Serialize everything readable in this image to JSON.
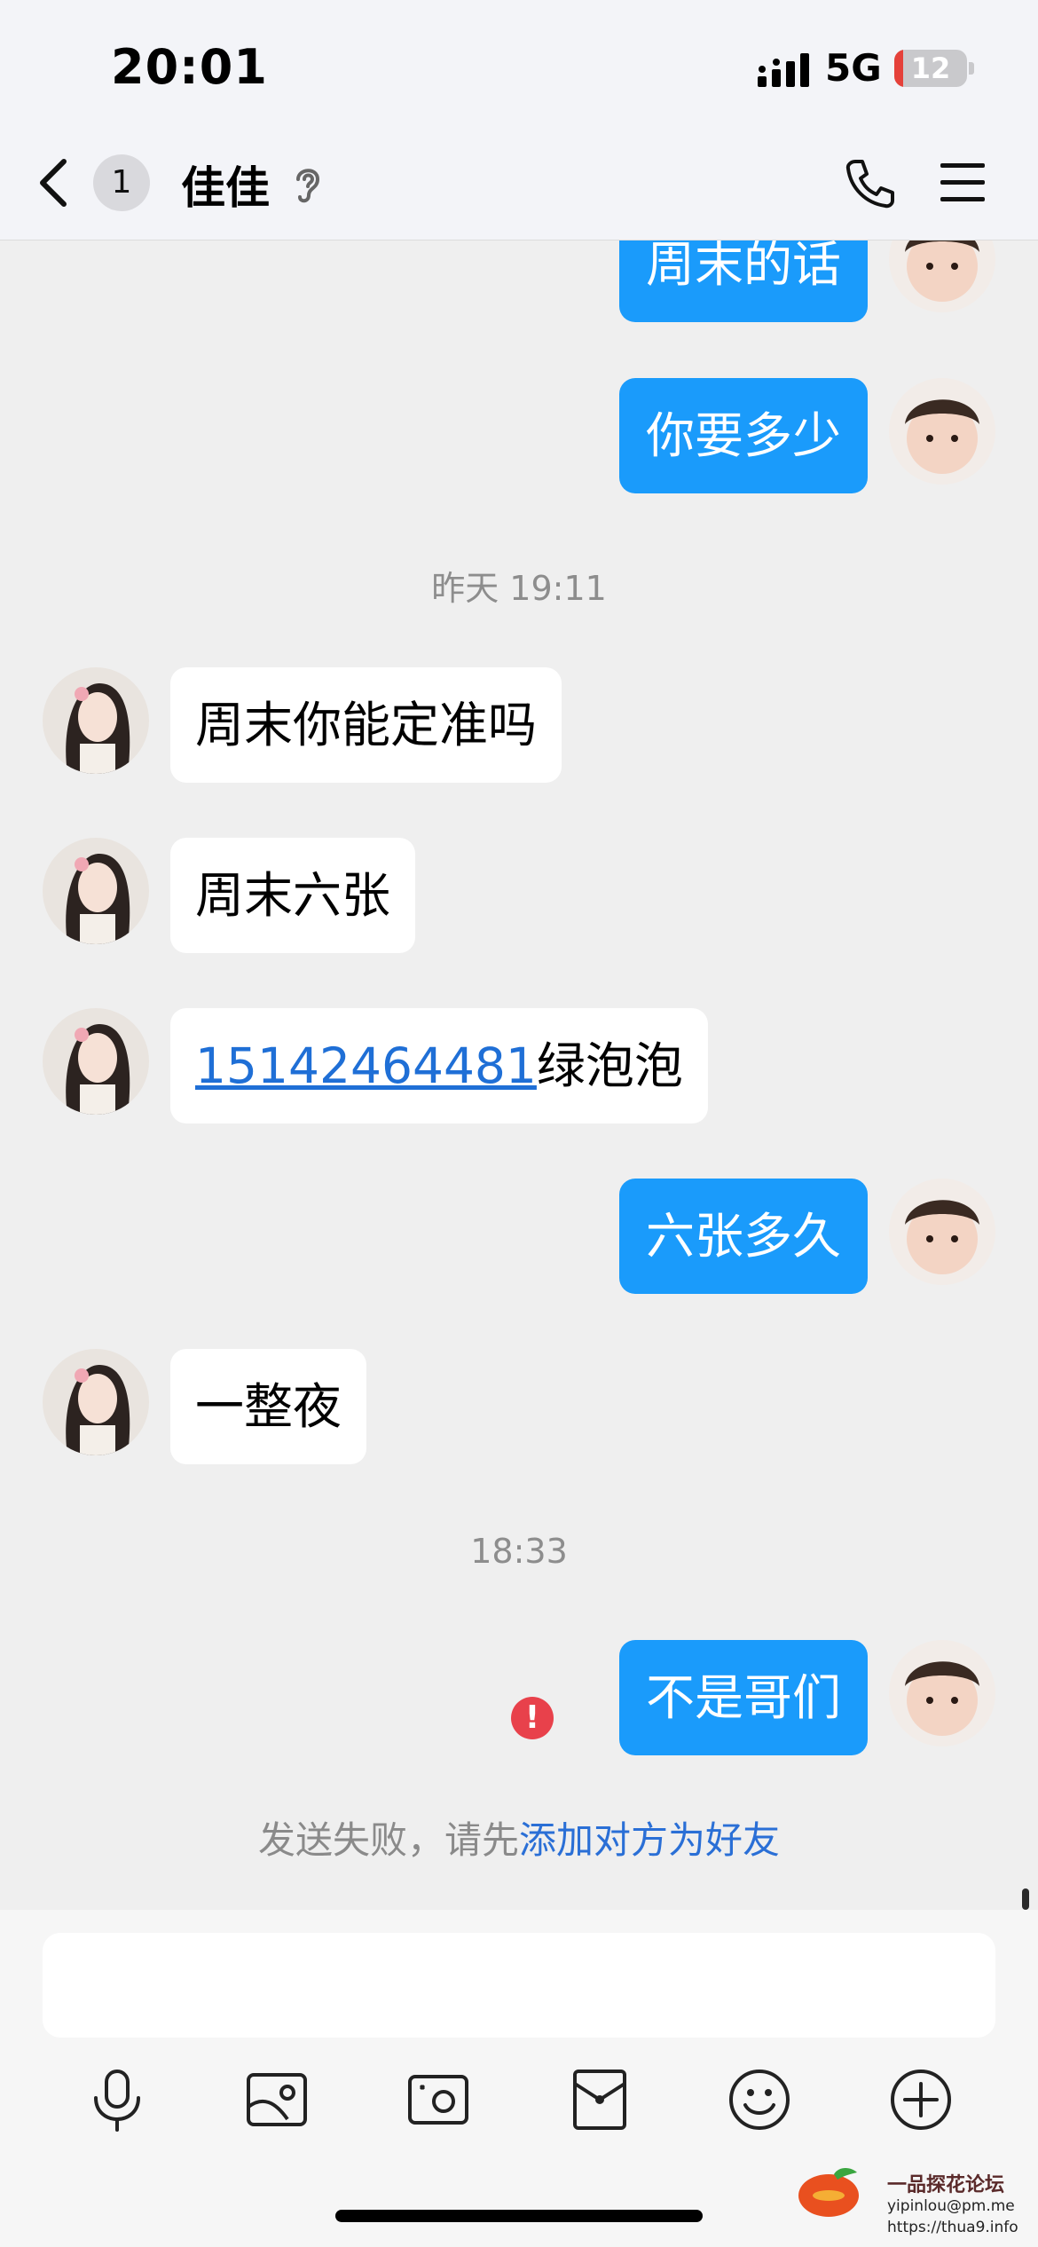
{
  "status_bar": {
    "time": "20:01",
    "network": "5G",
    "battery": "12",
    "battery_level": 0.12
  },
  "nav": {
    "back_badge": "1",
    "title": "佳佳"
  },
  "messages": [
    {
      "side": "out",
      "text": "周末的话"
    },
    {
      "side": "out",
      "text": "你要多少"
    },
    {
      "type": "timestamp",
      "text": "昨天 19:11"
    },
    {
      "side": "in",
      "text": "周末你能定准吗"
    },
    {
      "side": "in",
      "text": "周末六张"
    },
    {
      "side": "in",
      "phone": "15142464481",
      "text": "绿泡泡"
    },
    {
      "side": "out",
      "text": "六张多久"
    },
    {
      "side": "in",
      "text": "一整夜"
    },
    {
      "type": "timestamp",
      "text": "18:33"
    },
    {
      "side": "out",
      "text": "不是哥们",
      "failed": true
    }
  ],
  "send_failed": {
    "prefix": "发送失败，请先",
    "link": "添加对方为好友"
  },
  "error_icon": "!",
  "toolbar": [
    "microphone-icon",
    "photo-icon",
    "camera-icon",
    "red-packet-icon",
    "emoji-icon",
    "plus-icon"
  ],
  "watermark": {
    "title": "一品探花论坛",
    "email": "yipinlou@pm.me",
    "url": "https://thua9.info"
  },
  "colors": {
    "outgoing_bubble": "#1a9bfb",
    "incoming_bubble": "#ffffff",
    "link": "#2a6fd6",
    "error": "#e8414b"
  }
}
